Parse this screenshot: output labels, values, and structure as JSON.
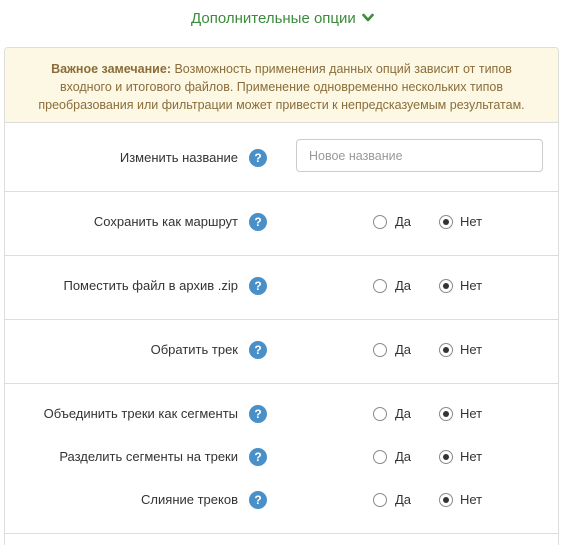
{
  "header": {
    "toggle_label": "Дополнительные опции",
    "icon": "chevron-down-icon",
    "color": "#3c8b3c"
  },
  "notice": {
    "strong": "Важное замечание:",
    "text": " Возможность применения данных опций зависит от типов входного и итогового файлов. Применение одновременно нескольких типов преобразования или фильтрации может привести к непредсказуемым результатам.",
    "color": "#8a6d3b",
    "background": "#fcf8e3"
  },
  "options": {
    "rename": {
      "label": "Изменить название",
      "placeholder": "Новое название",
      "value": ""
    },
    "route": {
      "label": "Сохранить как маршрут",
      "selected": "no"
    },
    "zip": {
      "label": "Поместить файл в архив .zip",
      "selected": "no"
    },
    "reverse": {
      "label": "Обратить трек",
      "selected": "no"
    },
    "merge_segments": {
      "label": "Объединить треки как сегменты",
      "selected": "no"
    },
    "split_segments": {
      "label": "Разделить сегменты на треки",
      "selected": "no"
    },
    "merge_tracks": {
      "label": "Слияние треков",
      "selected": "no"
    }
  },
  "radio": {
    "yes": "Да",
    "no": "Нет"
  },
  "help_icon": {
    "glyph": "?",
    "color": "#4a90c8"
  }
}
